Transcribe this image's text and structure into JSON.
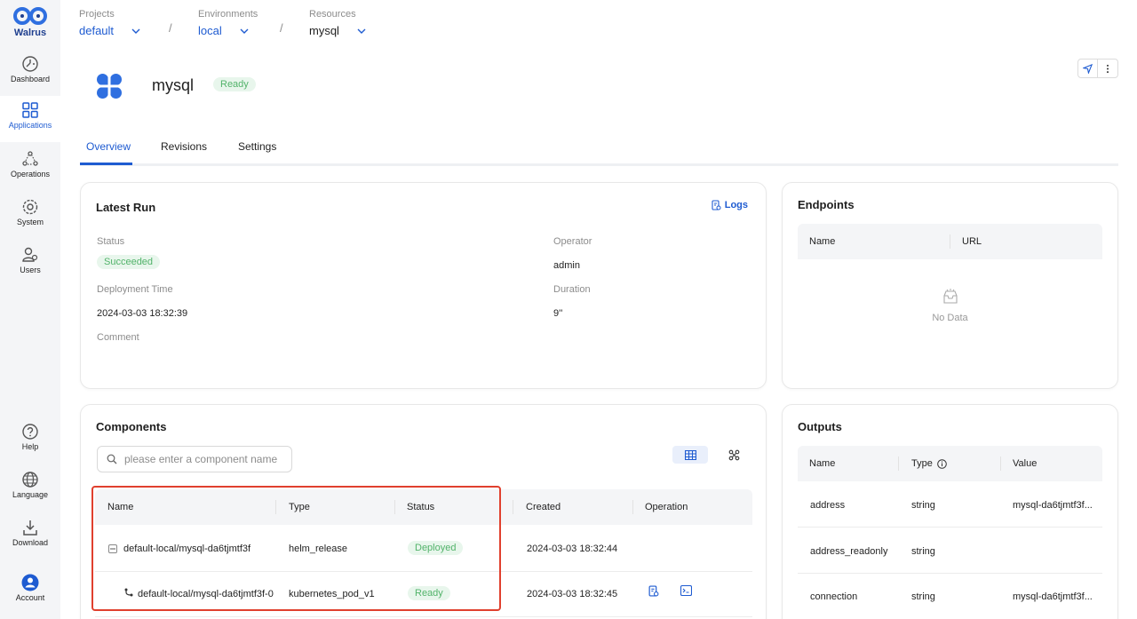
{
  "brand": {
    "name": "Walrus"
  },
  "sidebar": {
    "items": [
      {
        "label": "Dashboard",
        "icon": "dashboard-icon"
      },
      {
        "label": "Applications",
        "icon": "applications-icon"
      },
      {
        "label": "Operations",
        "icon": "operations-icon"
      },
      {
        "label": "System",
        "icon": "gear-icon"
      },
      {
        "label": "Users",
        "icon": "users-icon"
      }
    ],
    "bottom_items": [
      {
        "label": "Help",
        "icon": "help-icon"
      },
      {
        "label": "Language",
        "icon": "globe-icon"
      },
      {
        "label": "Download",
        "icon": "download-icon"
      },
      {
        "label": "Account",
        "icon": "account-icon"
      }
    ]
  },
  "breadcrumb": {
    "project": {
      "caption": "Projects",
      "value": "default"
    },
    "environment": {
      "caption": "Environments",
      "value": "local"
    },
    "resource": {
      "caption": "Resources",
      "value": "mysql"
    },
    "separator": "/"
  },
  "resource": {
    "name": "mysql",
    "status": "Ready"
  },
  "tabs": [
    "Overview",
    "Revisions",
    "Settings"
  ],
  "latest_run": {
    "title": "Latest Run",
    "logs_label": "Logs",
    "status_caption": "Status",
    "status_value": "Succeeded",
    "operator_caption": "Operator",
    "operator_value": "admin",
    "deploy_time_caption": "Deployment Time",
    "deploy_time_value": "2024-03-03 18:32:39",
    "duration_caption": "Duration",
    "duration_value": "9''",
    "comment_caption": "Comment"
  },
  "endpoints": {
    "title": "Endpoints",
    "columns": [
      "Name",
      "URL"
    ],
    "empty_text": "No Data"
  },
  "components": {
    "title": "Components",
    "search_placeholder": "please enter a component name",
    "columns": [
      "Name",
      "Type",
      "Status",
      "Created",
      "Operation"
    ],
    "rows": [
      {
        "name": "default-local/mysql-da6tjmtf3f",
        "type": "helm_release",
        "status": "Deployed",
        "created": "2024-03-03 18:32:44"
      },
      {
        "name": "default-local/mysql-da6tjmtf3f-0",
        "type": "kubernetes_pod_v1",
        "status": "Ready",
        "created": "2024-03-03 18:32:45"
      }
    ]
  },
  "outputs": {
    "title": "Outputs",
    "columns": [
      "Name",
      "Type",
      "Value"
    ],
    "rows": [
      {
        "name": "address",
        "type": "string",
        "value": "mysql-da6tjmtf3f..."
      },
      {
        "name": "address_readonly",
        "type": "string",
        "value": ""
      },
      {
        "name": "connection",
        "type": "string",
        "value": "mysql-da6tjmtf3f..."
      }
    ]
  },
  "colors": {
    "accent": "#1e5bd1",
    "success": "#52b36a",
    "highlight": "#e0402e"
  }
}
